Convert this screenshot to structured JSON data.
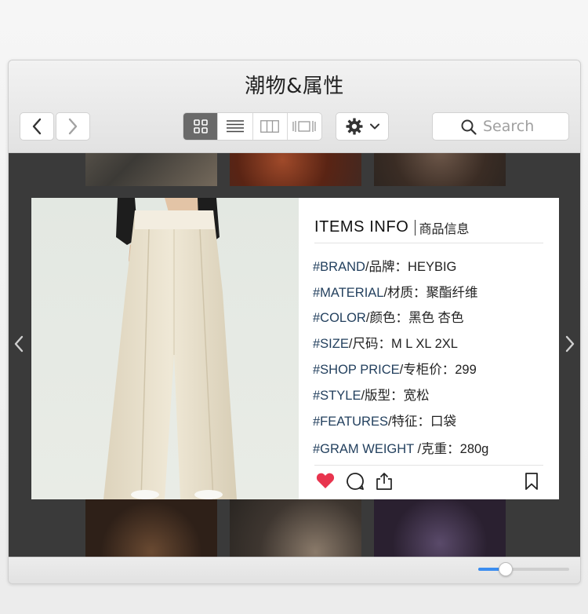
{
  "window": {
    "title": "潮物&属性"
  },
  "toolbar": {
    "back_icon": "chevron-left-icon",
    "forward_icon": "chevron-right-icon",
    "view_modes": [
      "grid-view-icon",
      "list-view-icon",
      "column-view-icon",
      "cover-flow-icon"
    ],
    "active_view": "grid-view-icon",
    "action_icon": "gear-icon"
  },
  "search": {
    "placeholder": "Search"
  },
  "card": {
    "title": "ITEMS INFO",
    "subtitle": "商品信息",
    "attributes": [
      {
        "tag": "#BRAND",
        "text": "/品牌：HEYBIG"
      },
      {
        "tag": "#MATERIAL",
        "text": "/材质：聚酯纤维"
      },
      {
        "tag": "#COLOR",
        "text": "/颜色：黑色 杏色"
      },
      {
        "tag": "#SIZE",
        "text": "/尺码：M L XL 2XL"
      },
      {
        "tag": "#SHOP PRICE",
        "text": "/专柜价：299"
      },
      {
        "tag": "#STYLE",
        "text": "/版型：宽松"
      },
      {
        "tag": "#FEATURES",
        "text": "/特征：口袋"
      },
      {
        "tag": "#GRAM WEIGHT",
        "text": " /克重：280g"
      }
    ],
    "actions": [
      "heart-icon",
      "comment-icon",
      "share-icon",
      "bookmark-icon"
    ]
  },
  "footer": {
    "zoom_level": 0.3
  },
  "colors": {
    "tag": "#23405e",
    "heart": "#e8344e",
    "slider": "#3b8df0"
  }
}
